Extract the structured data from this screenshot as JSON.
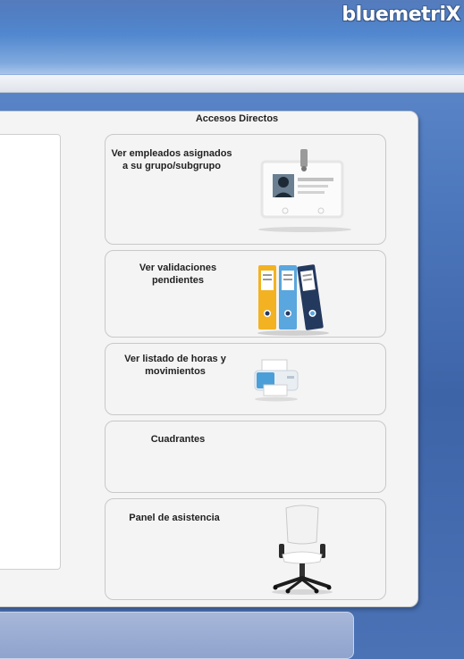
{
  "header": {
    "brand": "bluemetriX"
  },
  "shortcuts": {
    "title": "Accesos Directos",
    "items": [
      {
        "label": "Ver empleados asignados\na su grupo/subgrupo",
        "icon": "id-badge-icon"
      },
      {
        "label": "Ver validaciones\npendientes",
        "icon": "binders-icon"
      },
      {
        "label": "Ver listado de horas y\nmovimientos",
        "icon": "printer-icon"
      },
      {
        "label": "Cuadrantes",
        "icon": ""
      },
      {
        "label": "Panel de asistencia",
        "icon": "office-chair-icon"
      }
    ]
  },
  "colors": {
    "header_blue": "#4f86cf",
    "binder_yellow": "#f2b222",
    "binder_blue": "#5aa6de",
    "binder_navy": "#24395e"
  }
}
